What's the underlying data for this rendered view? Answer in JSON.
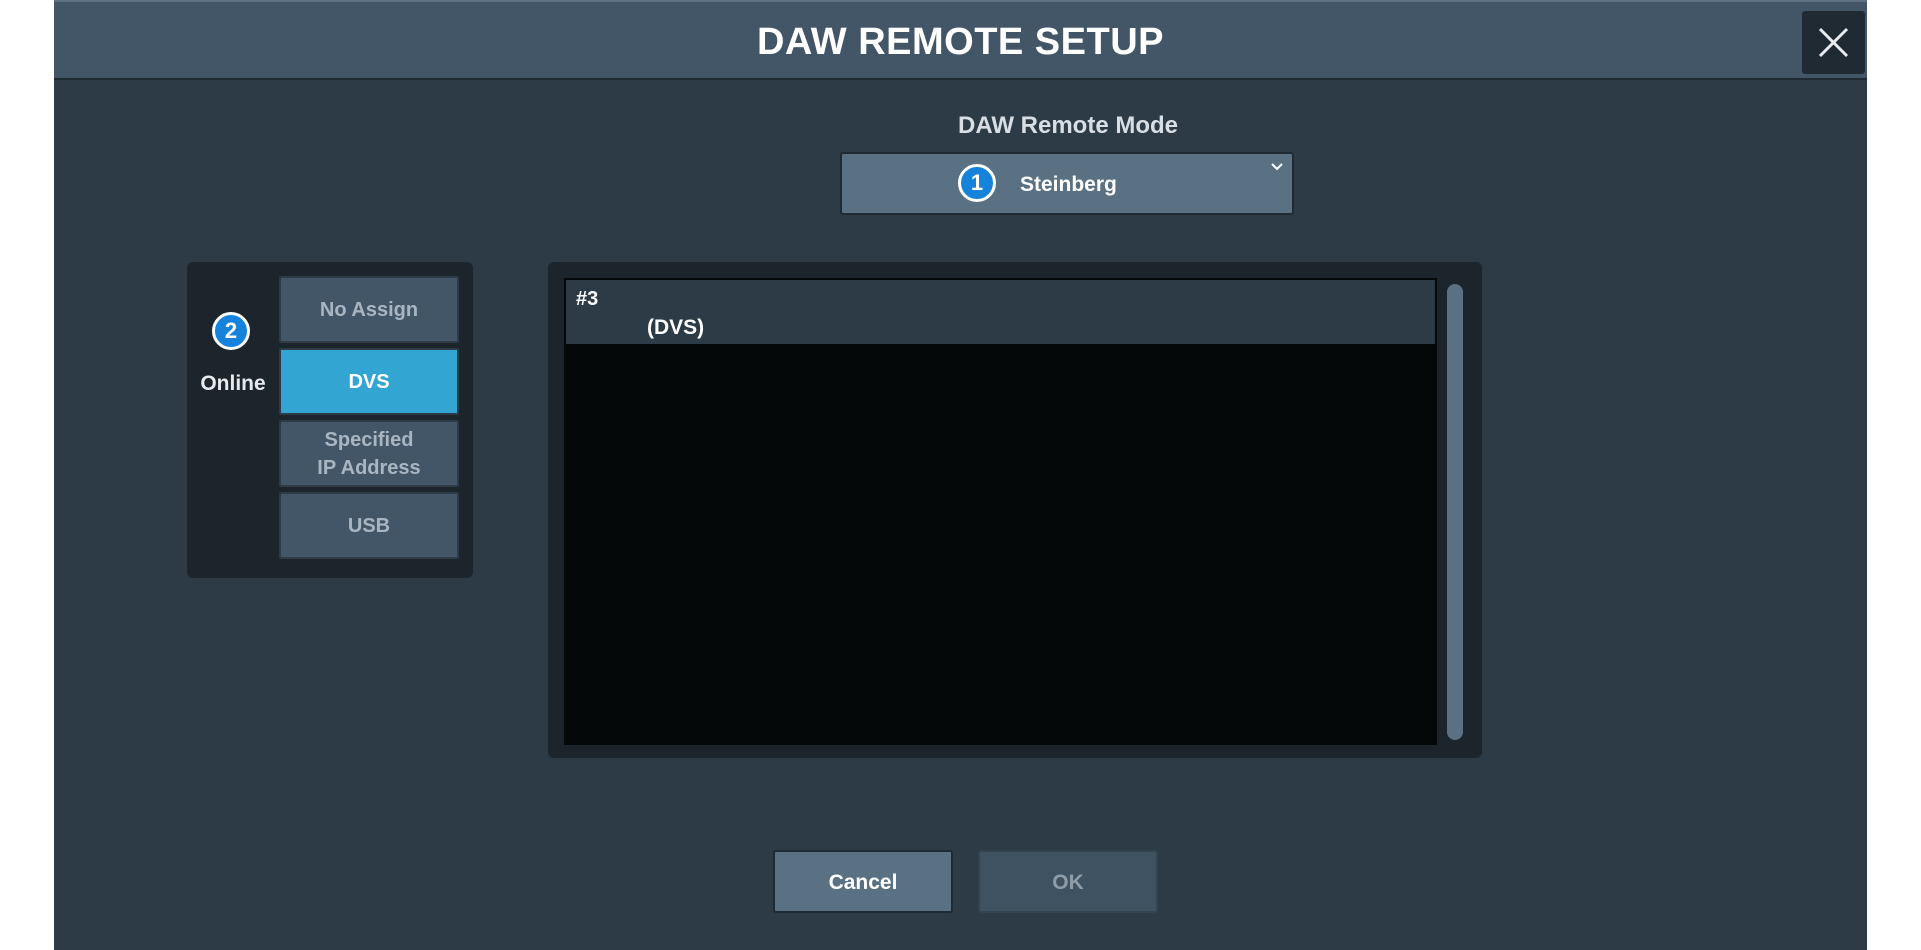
{
  "dialog": {
    "title": "DAW REMOTE SETUP",
    "close_icon": "close-icon"
  },
  "mode": {
    "label": "DAW Remote Mode",
    "badge": "1",
    "selected": "Steinberg"
  },
  "connection": {
    "badge": "2",
    "status": "Online",
    "options": [
      {
        "line1": "No Assign",
        "line2": "",
        "active": false
      },
      {
        "line1": "DVS",
        "line2": "",
        "active": true
      },
      {
        "line1": "Specified",
        "line2": "IP Address",
        "active": false
      },
      {
        "line1": "USB",
        "line2": "",
        "active": false
      }
    ]
  },
  "device_list": {
    "items": [
      {
        "id": "#3",
        "name": "(DVS)",
        "selected": true
      }
    ]
  },
  "footer": {
    "cancel": "Cancel",
    "ok": "OK",
    "ok_enabled": false
  },
  "colors": {
    "background": "#2c3b46",
    "titlebar": "#435668",
    "active_option": "#33a5d3",
    "badge": "#1583db"
  }
}
